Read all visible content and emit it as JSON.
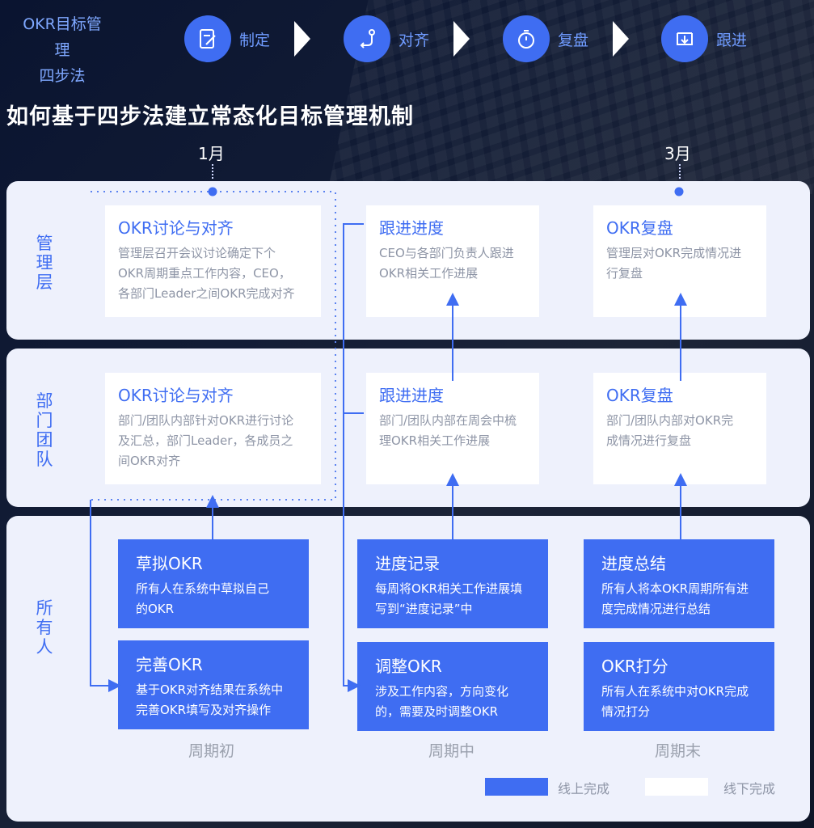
{
  "steps_title": "OKR目标管理四步法",
  "steps_title_lines": [
    "OKR目标管理",
    "四步法"
  ],
  "steps": [
    {
      "label": "制定",
      "icon": "edit-document-icon"
    },
    {
      "label": "对齐",
      "icon": "align-route-icon"
    },
    {
      "label": "复盘",
      "icon": "stopwatch-icon"
    },
    {
      "label": "跟进",
      "icon": "download-tray-icon"
    }
  ],
  "main_title": "如何基于四步法建立常态化目标管理机制",
  "months": [
    "1月",
    "3月"
  ],
  "rows": [
    {
      "label_lines": [
        "管",
        "理",
        "层"
      ]
    },
    {
      "label_lines": [
        "部",
        "门",
        "团",
        "队"
      ]
    },
    {
      "label_lines": [
        "所",
        "有",
        "人"
      ]
    }
  ],
  "management": [
    {
      "title": "OKR讨论与对齐",
      "desc": [
        "管理层召开会议讨论确定下个",
        "OKR周期重点工作内容，CEO，",
        "各部门Leader之间OKR完成对齐"
      ]
    },
    {
      "title": "跟进进度",
      "desc": [
        "CEO与各部门负责人跟进",
        "OKR相关工作进展"
      ]
    },
    {
      "title": "OKR复盘",
      "desc": [
        "管理层对OKR完成情况进",
        "行复盘"
      ]
    }
  ],
  "department": [
    {
      "title": "OKR讨论与对齐",
      "desc": [
        "部门/团队内部针对OKR进行讨论",
        "及汇总，部门Leader，各成员之",
        "间OKR对齐"
      ]
    },
    {
      "title": "跟进进度",
      "desc": [
        "部门/团队内部在周会中梳",
        "理OKR相关工作进展"
      ]
    },
    {
      "title": "OKR复盘",
      "desc": [
        "部门/团队内部对OKR完",
        "成情况进行复盘"
      ]
    }
  ],
  "everyone": [
    {
      "title": "草拟OKR",
      "desc": [
        "所有人在系统中草拟自己",
        "的OKR"
      ]
    },
    {
      "title": "进度记录",
      "desc": [
        "每周将OKR相关工作进展填",
        "写到“进度记录”中"
      ]
    },
    {
      "title": "进度总结",
      "desc": [
        "所有人将本OKR周期所有进",
        "度完成情况进行总结"
      ]
    },
    {
      "title": "完善OKR",
      "desc": [
        "基于OKR对齐结果在系统中",
        "完善OKR填写及对齐操作"
      ]
    },
    {
      "title": "调整OKR",
      "desc": [
        "涉及工作内容，方向变化",
        "的，需要及时调整OKR"
      ]
    },
    {
      "title": "OKR打分",
      "desc": [
        "所有人在系统中对OKR完成",
        "情况打分"
      ]
    }
  ],
  "periods": [
    "周期初",
    "周期中",
    "周期末"
  ],
  "legend": {
    "online": "线上完成",
    "offline": "线下完成"
  },
  "colors": {
    "accent": "#3f6df2",
    "panel": "#eef1fc",
    "card": "#ffffff",
    "muted_text": "#8e95a6"
  }
}
